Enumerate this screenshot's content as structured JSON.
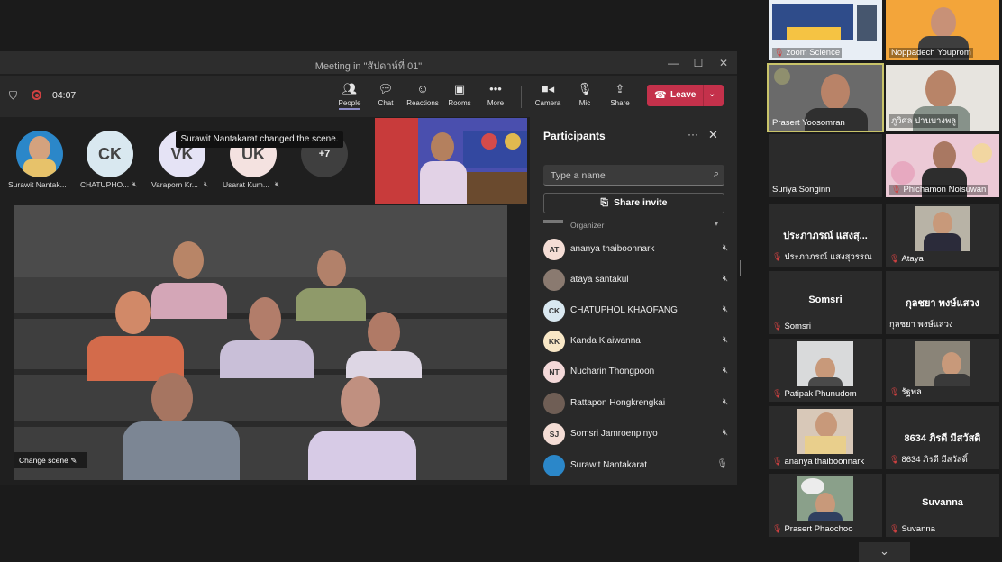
{
  "window": {
    "title": "Meeting in \"สัปดาห์ที่ 01\"",
    "minimize_icon": "minimize-icon",
    "maximize_icon": "maximize-icon",
    "close_icon": "close-icon"
  },
  "toolbar": {
    "timer": "04:07",
    "buttons": [
      {
        "label": "People",
        "icon": "people-icon"
      },
      {
        "label": "Chat",
        "icon": "chat-icon"
      },
      {
        "label": "Reactions",
        "icon": "reactions-icon"
      },
      {
        "label": "Rooms",
        "icon": "rooms-icon"
      },
      {
        "label": "More",
        "icon": "more-icon"
      },
      {
        "label": "Camera",
        "icon": "camera-icon"
      },
      {
        "label": "Mic",
        "icon": "mic-icon"
      },
      {
        "label": "Share",
        "icon": "share-icon"
      }
    ],
    "leave_label": "Leave"
  },
  "strip": {
    "participants": [
      {
        "initials": "",
        "name": "Surawit Nantak...",
        "color": "#2b87c9"
      },
      {
        "initials": "CK",
        "name": "CHATUPHO...",
        "color": "#d9e8f0"
      },
      {
        "initials": "VK",
        "name": "Varaporn Kr...",
        "color": "#e5e3f5"
      },
      {
        "initials": "UK",
        "name": "Usarat Kum...",
        "color": "#f4e2e0"
      }
    ],
    "more_count": "+7",
    "tooltip": "Surawit Nantakarat changed the scene."
  },
  "stage": {
    "change_scene_label": "Change scene"
  },
  "panel": {
    "title": "Participants",
    "search_placeholder": "Type a name",
    "share_invite_label": "Share invite",
    "section": "Organizer",
    "people": [
      {
        "initials": "AT",
        "name": "ananya thaiboonnark",
        "color": "#f4ddd5",
        "mic": "mic-off"
      },
      {
        "initials": "",
        "name": "ataya santakul",
        "color": "#8a7a70",
        "mic": "mic-off"
      },
      {
        "initials": "CK",
        "name": "CHATUPHOL KHAOFANG",
        "color": "#d9e8f0",
        "mic": "mic-off"
      },
      {
        "initials": "KK",
        "name": "Kanda Klaiwanna",
        "color": "#f8e7c6",
        "mic": "mic-off"
      },
      {
        "initials": "NT",
        "name": "Nucharin Thongpoon",
        "color": "#f4d9d9",
        "mic": "mic-off"
      },
      {
        "initials": "",
        "name": "Rattapon Hongkrengkai",
        "color": "#6f5e55",
        "mic": "mic-off"
      },
      {
        "initials": "SJ",
        "name": "Somsri Jamroenpinyo",
        "color": "#f4ddd5",
        "mic": "mic-off"
      },
      {
        "initials": "",
        "name": "Surawit Nantakarat",
        "color": "#2b87c9",
        "mic": "mic-on"
      }
    ]
  },
  "grid": {
    "tiles": [
      {
        "name": "zoom Science",
        "big": "",
        "muted": true
      },
      {
        "name": "Noppadech Youprom",
        "big": "",
        "muted": false
      },
      {
        "name": "Prasert Yoosomran",
        "big": "",
        "muted": false
      },
      {
        "name": "ภูวิศล ปานบางพลู",
        "big": "",
        "muted": false
      },
      {
        "name": "Suriya Songinn",
        "big": "",
        "muted": false
      },
      {
        "name": "Phichamon Noisuwan",
        "big": "",
        "muted": true
      },
      {
        "name": "ประภาภรณ์ แสงสุวรรณ",
        "big": "ประภาภรณ์ แสงสุ...",
        "muted": true
      },
      {
        "name": "Ataya",
        "big": "",
        "muted": true
      },
      {
        "name": "Somsri",
        "big": "Somsri",
        "muted": true
      },
      {
        "name": "กุลชยา พงษ์แสวง",
        "big": "กุลชยา พงษ์แสวง",
        "muted": false
      },
      {
        "name": "Patipak Phunudom",
        "big": "",
        "muted": true
      },
      {
        "name": "รัฐพล",
        "big": "",
        "muted": true
      },
      {
        "name": "ananya thaiboonnark",
        "big": "",
        "muted": true
      },
      {
        "name": "8634 ภิรดี มีสวัสดิ์",
        "big": "8634 ภิรดี มีสวัสดิ",
        "muted": true
      },
      {
        "name": "Prasert  Phaochoo",
        "big": "",
        "muted": true
      },
      {
        "name": "Suvanna",
        "big": "Suvanna",
        "muted": true
      }
    ]
  },
  "colors": {
    "leave": "#c4314b",
    "active_tab": "#8b8cc7",
    "muted_red": "#d04141",
    "speaker_highlight": "#c9c46a"
  }
}
